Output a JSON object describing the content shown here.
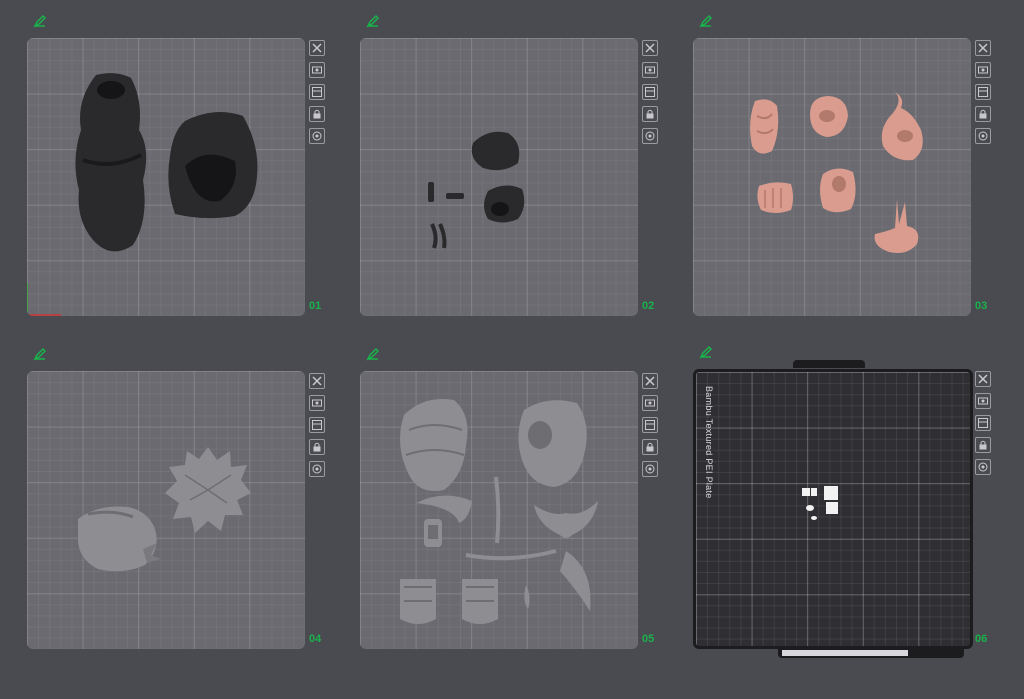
{
  "plates": [
    {
      "number": "01"
    },
    {
      "number": "02"
    },
    {
      "number": "03"
    },
    {
      "number": "04"
    },
    {
      "number": "05"
    },
    {
      "number": "06",
      "label": "Bambu Textured PEI Plate"
    }
  ],
  "tools": [
    "close-icon",
    "auto-orient-icon",
    "arrange-icon",
    "lock-icon",
    "settings-icon"
  ],
  "colors": {
    "accent": "#19b24b",
    "background": "#4a4a51",
    "plate": "#6a6a70",
    "dark_plate": "#2f2f33",
    "part_dark": "#2a2a2c",
    "part_skin": "#d99c8e",
    "part_grey": "#8e8e92"
  }
}
